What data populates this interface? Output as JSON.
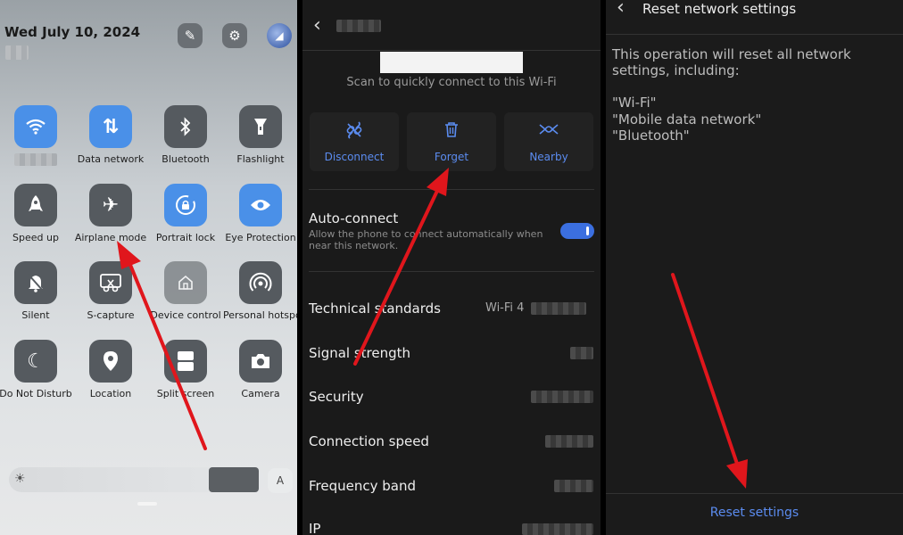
{
  "quick_settings": {
    "date": "Wed July 10, 2024",
    "tiles": [
      {
        "label": "",
        "icon": "wifi-icon",
        "state": "on"
      },
      {
        "label": "Data network",
        "icon": "data-network-icon",
        "state": "on"
      },
      {
        "label": "Bluetooth",
        "icon": "bluetooth-icon",
        "state": "off"
      },
      {
        "label": "Flashlight",
        "icon": "flashlight-icon",
        "state": "off"
      },
      {
        "label": "Speed up",
        "icon": "rocket-icon",
        "state": "off"
      },
      {
        "label": "Airplane mode",
        "icon": "airplane-icon",
        "state": "off"
      },
      {
        "label": "Portrait lock",
        "icon": "rotation-lock-icon",
        "state": "on"
      },
      {
        "label": "Eye Protection",
        "icon": "eye-icon",
        "state": "on"
      },
      {
        "label": "Silent",
        "icon": "bell-off-icon",
        "state": "off"
      },
      {
        "label": "S-capture",
        "icon": "scissors-icon",
        "state": "off"
      },
      {
        "label": "Device control",
        "icon": "home-icon",
        "state": "dim"
      },
      {
        "label": "Personal hotspot",
        "icon": "hotspot-icon",
        "state": "off"
      },
      {
        "label": "Do Not Disturb",
        "icon": "moon-icon",
        "state": "off"
      },
      {
        "label": "Location",
        "icon": "location-pin-icon",
        "state": "off"
      },
      {
        "label": "Split screen",
        "icon": "split-screen-icon",
        "state": "off"
      },
      {
        "label": "Camera",
        "icon": "camera-icon",
        "state": "off"
      }
    ],
    "auto_brightness_label": "A"
  },
  "wifi_details": {
    "scan_text": "Scan to quickly connect to this Wi-Fi",
    "actions": [
      {
        "label": "Disconnect",
        "icon": "link-off-icon"
      },
      {
        "label": "Forget",
        "icon": "trash-icon"
      },
      {
        "label": "Nearby",
        "icon": "nearby-share-icon"
      }
    ],
    "auto_connect": {
      "title": "Auto-connect",
      "description": "Allow the phone to connect automatically when near this network.",
      "enabled": true
    },
    "rows": [
      {
        "label": "Technical standards",
        "value": "Wi-Fi 4"
      },
      {
        "label": "Signal strength",
        "value": ""
      },
      {
        "label": "Security",
        "value": ""
      },
      {
        "label": "Connection speed",
        "value": ""
      },
      {
        "label": "Frequency band",
        "value": ""
      },
      {
        "label": "IP",
        "value": ""
      }
    ]
  },
  "reset": {
    "title": "Reset network settings",
    "description": "This operation will reset all network settings, including:",
    "items": [
      "\"Wi-Fi\"",
      "\"Mobile data network\"",
      "\"Bluetooth\""
    ],
    "button_label": "Reset settings"
  },
  "colors": {
    "accent": "#5b8cf0",
    "tile_on": "#4a90e8",
    "arrow": "#e0161c"
  }
}
